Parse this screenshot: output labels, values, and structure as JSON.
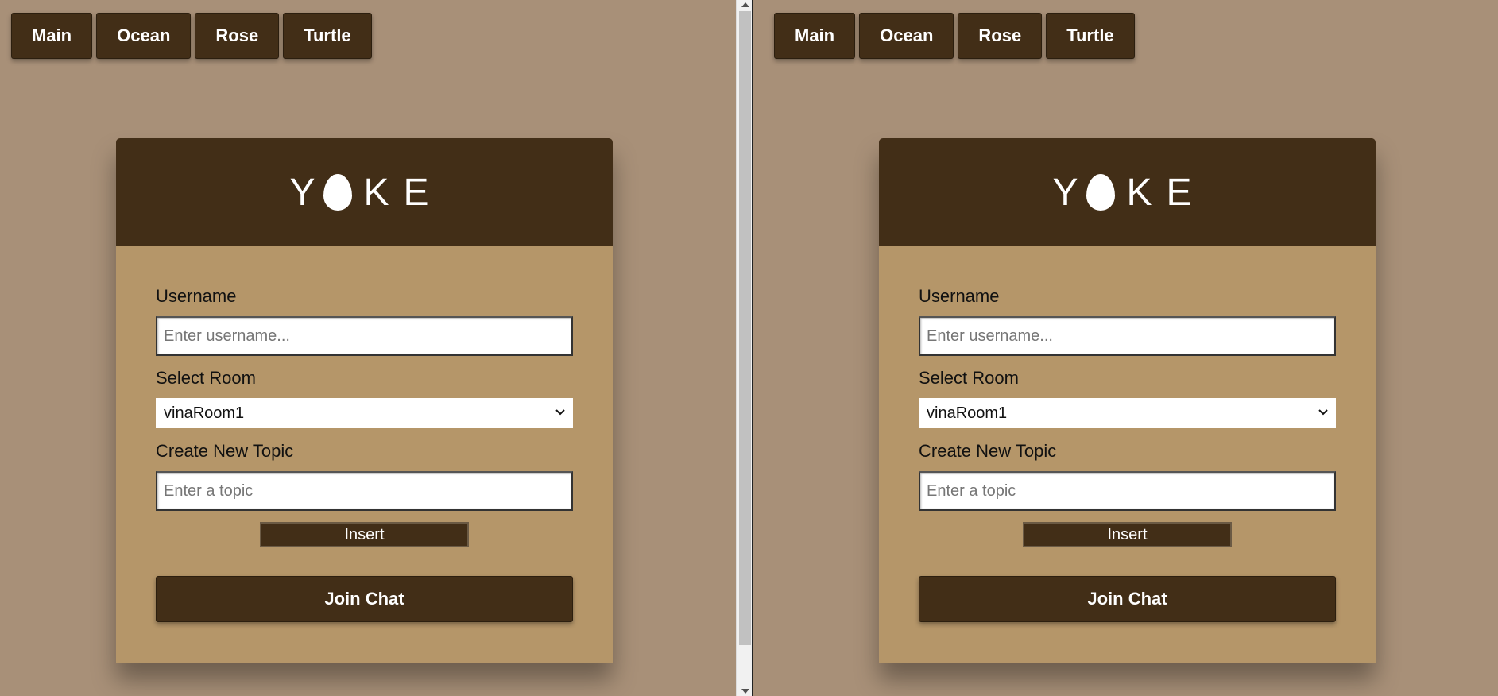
{
  "nav": {
    "items": [
      "Main",
      "Ocean",
      "Rose",
      "Turtle"
    ]
  },
  "brand": {
    "letters_before_egg": "Y",
    "letters_after_egg": "KE",
    "egg_icon": "egg-icon"
  },
  "form": {
    "username_label": "Username",
    "username_placeholder": "Enter username...",
    "username_value": "",
    "room_label": "Select Room",
    "room_selected": "vinaRoom1",
    "topic_label": "Create New Topic",
    "topic_placeholder": "Enter a topic",
    "topic_value": "",
    "insert_label": "Insert",
    "join_label": "Join Chat"
  },
  "colors": {
    "page_background": "#a89078",
    "primary_dark_brown": "#422e17",
    "card_body_tan": "#b59669",
    "text_light": "#ffffff"
  }
}
